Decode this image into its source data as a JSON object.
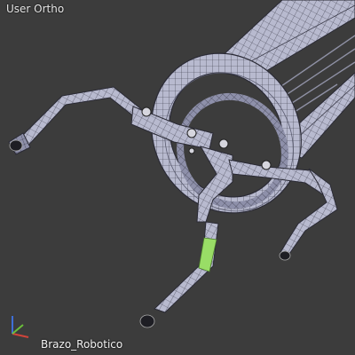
{
  "viewport": {
    "view_label": "User Ortho",
    "object_name": "Brazo_Robotico",
    "background_color": "#3c3c3c"
  },
  "mesh": {
    "fill_color": "#b7b9ce",
    "shadow_color": "#8f91aa",
    "wire_color": "#2b2b35",
    "selected_face_color": "#99dd66"
  },
  "axis_gizmo": {
    "x_color": "#d0443a",
    "y_color": "#6bbf3a",
    "z_color": "#3f6fd6",
    "icon": "axis-gizmo-icon"
  }
}
